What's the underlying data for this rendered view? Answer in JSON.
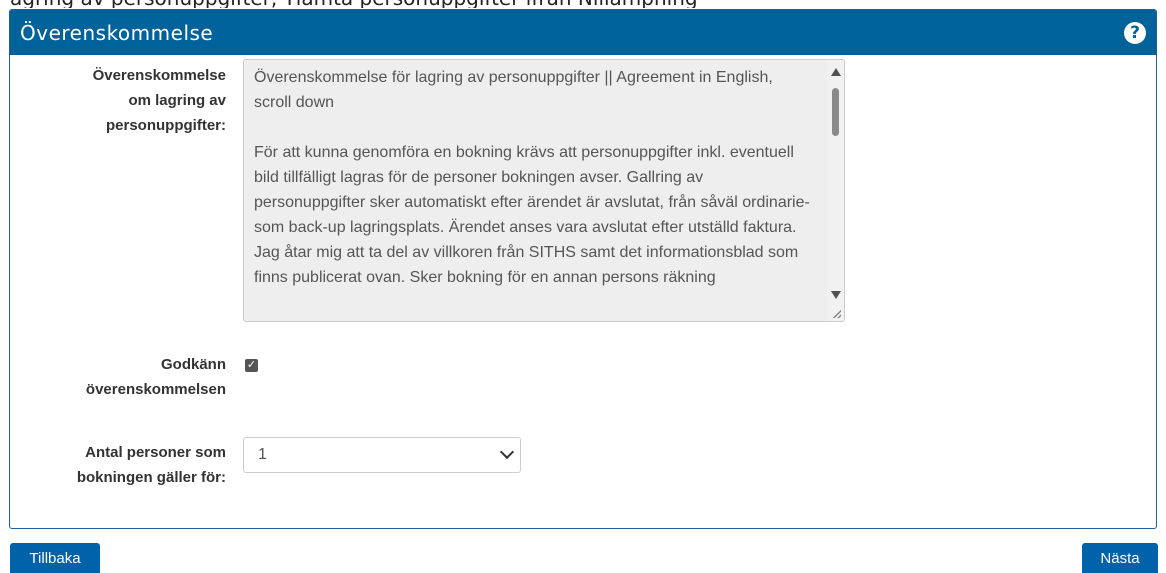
{
  "top_text": "agring av personuppgifter, Tlamta personuppgifter ifrån Nillämpning",
  "panel": {
    "title": "Överenskommelse",
    "help_glyph": "?"
  },
  "agreement": {
    "label": "Överenskommelse om lagring av personuppgifter:",
    "text": "Överenskommelse för lagring av personuppgifter || Agreement in English, scroll down\n\nFör att kunna genomföra en bokning krävs att personuppgifter inkl. eventuell bild tillfälligt lagras för de personer bokningen avser. Gallring av personuppgifter sker automatiskt efter ärendet är avslutat, från såväl ordinarie- som back-up lagringsplats. Ärendet anses vara avslutat efter utställd faktura.\nJag åtar mig att ta del av villkoren från SITHS samt det informationsblad som finns publicerat ovan. Sker bokning för en annan persons räkning"
  },
  "approve": {
    "label": "Godkänn överenskommelsen",
    "checked": true
  },
  "persons": {
    "label": "Antal personer som bokningen gäller för:",
    "value": "1"
  },
  "buttons": {
    "back": "Tillbaka",
    "next": "Nästa"
  },
  "colors": {
    "header": "#00629b",
    "button": "#0062a8"
  }
}
